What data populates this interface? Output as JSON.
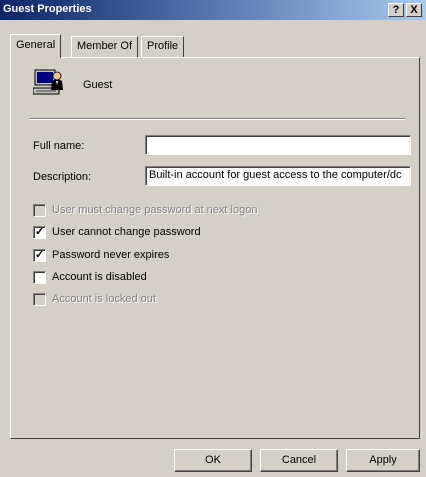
{
  "window": {
    "title": "Guest Properties",
    "help_label": "?",
    "close_label": "X"
  },
  "tabs": [
    {
      "label": "General"
    },
    {
      "label": "Member Of"
    },
    {
      "label": "Profile"
    }
  ],
  "account": {
    "name": "Guest",
    "icon": "user-account-icon"
  },
  "fields": {
    "full_name_label": "Full name:",
    "full_name_value": "",
    "description_label": "Description:",
    "description_value": "Built-in account for guest access to the computer/dc"
  },
  "checkboxes": [
    {
      "label": "User must change password at next logon",
      "checked": false,
      "disabled": true
    },
    {
      "label": "User cannot change password",
      "checked": true,
      "disabled": false
    },
    {
      "label": "Password never expires",
      "checked": true,
      "disabled": false
    },
    {
      "label": "Account is disabled",
      "checked": false,
      "disabled": false
    },
    {
      "label": "Account is locked out",
      "checked": false,
      "disabled": true
    }
  ],
  "buttons": {
    "ok": "OK",
    "cancel": "Cancel",
    "apply": "Apply"
  }
}
